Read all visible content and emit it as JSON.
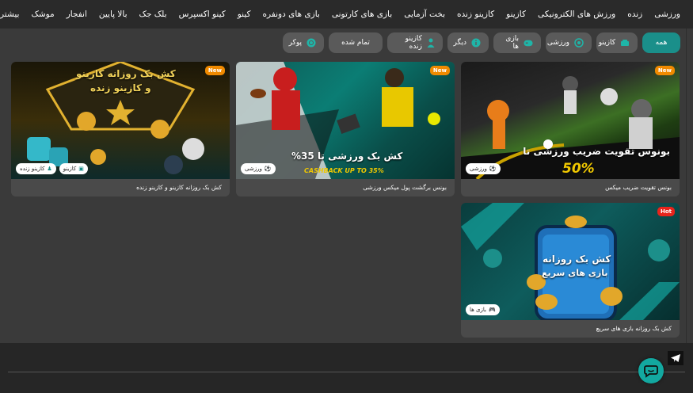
{
  "nav": {
    "items": [
      "ورزشی",
      "زنده",
      "ورزش های الکترونیکی",
      "کازینو",
      "کازینو زنده",
      "بخت آزمایی",
      "بازی های کارتونی",
      "بازی های دونفره",
      "کینو",
      "کینو اکسپرس",
      "بلک جک",
      "بالا پایین",
      "انفجار",
      "موشک",
      "بیشتر"
    ]
  },
  "filters": {
    "all": "همه",
    "casino": "کازینو",
    "sports": "ورزشی",
    "games": "بازی ها",
    "other": "دیگر",
    "live_casino": "کازینو زنده",
    "finished": "تمام شده",
    "poker": "پوکر"
  },
  "cards": [
    {
      "caption": "بونس تقویت ضریب میکس",
      "badge": "New",
      "tags": [
        "ورزشی"
      ],
      "banner_title": "بونوس تقویت ضریب ورزشی تا",
      "banner_value": "50%"
    },
    {
      "caption": "بونس برگشت پول میکس ورزشی",
      "badge": "New",
      "tags": [
        "ورزشی"
      ],
      "banner_title": "کش بک ورزشی تا 35%",
      "banner_sub": "CASHBACK UP TO 35%"
    },
    {
      "caption": "کش بک روزانه کازینو و کازینو زنده",
      "badge": "New",
      "tags": [
        "کازینو",
        "کازینو زنده"
      ],
      "banner_title_1": "کش بک روزانه کازینو",
      "banner_title_2": "و کازینو زنده"
    },
    {
      "caption": "کش بک روزانه بازی های سریع",
      "badge": "Hot",
      "tags": [
        "بازی ها"
      ],
      "banner_title_1": "کش بک روزانه",
      "banner_title_2": "بازی های سریع"
    }
  ],
  "colors": {
    "accent": "#1a8f8a",
    "badge_new": "#f08a00",
    "badge_hot": "#e8241c",
    "background": "#3a3a3a",
    "nav_bg": "#2a2a2a"
  }
}
